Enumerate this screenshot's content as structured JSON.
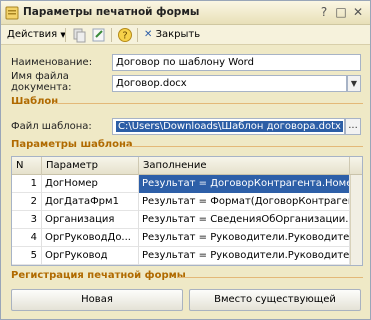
{
  "window": {
    "title": "Параметры печатной формы",
    "close_glyph": "✕",
    "maximize_glyph": "□",
    "help_glyph": "?"
  },
  "toolbar": {
    "actions_label": "Действия",
    "close_label": "Закрыть"
  },
  "form": {
    "name_label": "Наименование:",
    "name_value": "Договор по шаблону Word",
    "file_name_label_1": "Имя файла",
    "file_name_label_2": "документа:",
    "file_name_value": "Договор.docx",
    "template_section": "Шаблон",
    "template_file_label": "Файл шаблона:",
    "template_file_value": "C:\\Users\\Downloads\\Шаблон договора.dotx",
    "browse_glyph": "...",
    "params_section": "Параметры шаблона",
    "register_section": "Регистрация печатной формы"
  },
  "table": {
    "headers": [
      "N",
      "Параметр",
      "Заполнение"
    ],
    "rows": [
      {
        "n": "1",
        "param": "ДогНомер",
        "fill": "Результат = ДоговорКонтрагента.Номер;"
      },
      {
        "n": "2",
        "param": "ДогДатаФрм1",
        "fill": "Результат = Формат(ДоговорКонтрагента..."
      },
      {
        "n": "3",
        "param": "Организация",
        "fill": "Результат = СведенияОбОрганизации.Пол..."
      },
      {
        "n": "4",
        "param": "ОргРуководДо...",
        "fill": "Результат = Руководители.РуководительД..."
      },
      {
        "n": "5",
        "param": "ОргРуковод",
        "fill": "Результат = Руководители.Руководитель;"
      }
    ]
  },
  "buttons": {
    "new_label": "Новая",
    "replace_label": "Вместо существующей"
  },
  "colors": {
    "accent_section": "#b06a00",
    "selection": "#2d5fa8",
    "window_bg": "#efe9c6"
  }
}
